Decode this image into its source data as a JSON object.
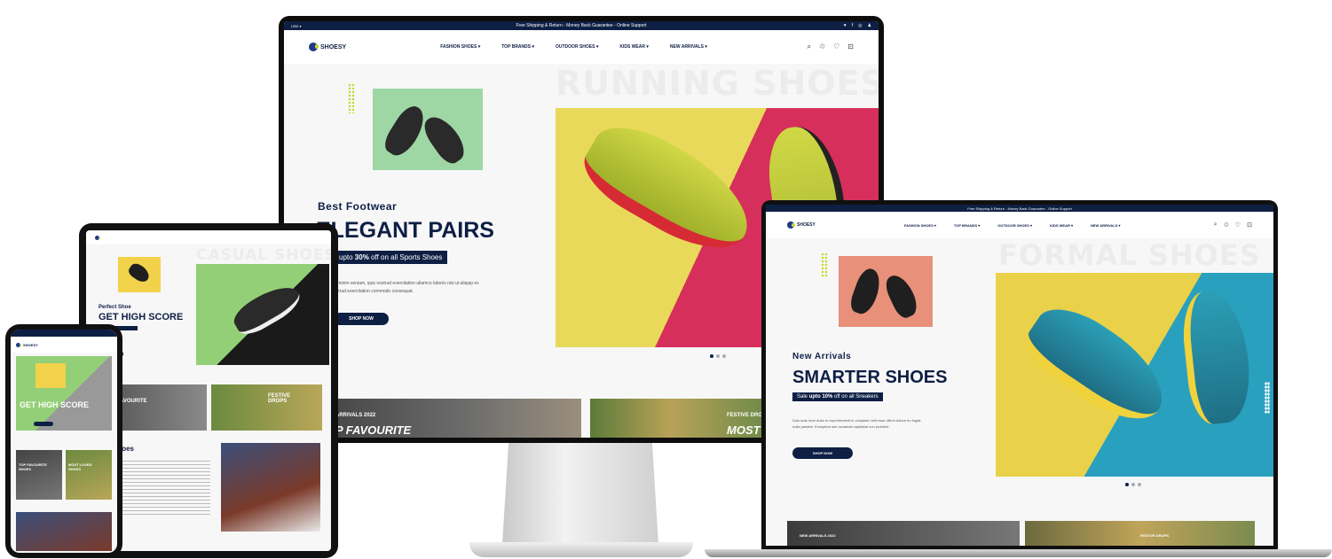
{
  "desktop": {
    "topbar": {
      "left": "USD ▾",
      "message": "Free Shipping & Return - Money Back Guarantee - Online Support",
      "social": [
        "♥",
        "f",
        "◎",
        "♟"
      ]
    },
    "logo": "SHOESY",
    "menu": [
      "FASHION SHOES ▾",
      "TOP BRANDS ▾",
      "OUTDOOR SHOES ▾",
      "KIDS WEAR ▾",
      "NEW ARRIVALS ▾"
    ],
    "watermark": "RUNNING SHOES",
    "eyebrow": "Best Footwear",
    "headline": "ELEGANT PAIRS",
    "promo_prefix": "upto ",
    "promo_bold": "30%",
    "promo_suffix": " off on all Sports Shoes",
    "body_line1": "d minim veniam, quis nostrud exercitation ullamco laboris nisi ut aliquip ex",
    "body_line2": "ostrud exercitation commodo consequat.",
    "cta": "SHOP NOW",
    "banner1_small": "ARRIVALS 2022",
    "banner1_big": "P FAVOURITE",
    "banner2_small": "FESTIVE DROPS",
    "banner2_big": "MOST L"
  },
  "laptop": {
    "topbar": {
      "message": "Free Shipping & Return - Money Back Guarantee - Online Support"
    },
    "logo": "SHOESY",
    "menu": [
      "FASHION SHOES ▾",
      "TOP BRANDS ▾",
      "OUTDOOR SHOES ▾",
      "KIDS WEAR ▾",
      "NEW ARRIVALS ▾"
    ],
    "watermark": "FORMAL SHOES",
    "eyebrow": "New Arrivals",
    "headline": "SMARTER SHOES",
    "promo_prefix": "Sale ",
    "promo_bold": "upto 10%",
    "promo_suffix": " off on all Sneakers",
    "body_line1": "Duis aute irure dolor in reprehenderit in voluptate velit esse cillum dolore eu fugiat",
    "body_line2": "nulla pariatur. Excepteur sint occaecat cupidatat non proident.",
    "cta": "SHOP NOW",
    "banner1_small": "NEW ARRIVALS 2022",
    "banner2_small": "FESTIVE DROPS"
  },
  "tablet": {
    "watermark": "CASUAL SHOES",
    "eyebrow": "Perfect Shoe",
    "headline": "GET HIGH SCORE",
    "card1_title": "AVOURITE",
    "card2_title": "FESTIVE\nDROPS",
    "section_title": "Shoes"
  },
  "phone": {
    "logo": "SHOESY",
    "headline": "GET HIGH SCORE",
    "card1_title": "TOP FAVOURITE\nSHOES",
    "card2_title": "MOST LOVED\nSHOES"
  }
}
